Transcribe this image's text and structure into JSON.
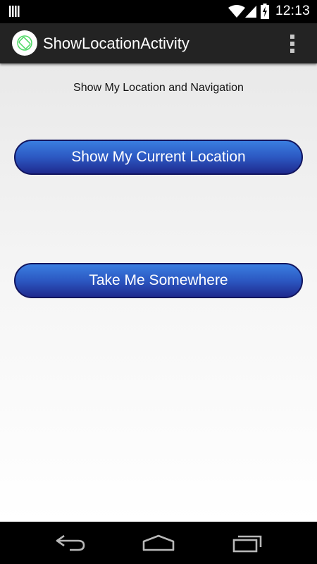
{
  "status_bar": {
    "time": "12:13",
    "icons": [
      "notification-icon",
      "wifi-icon",
      "signal-icon",
      "battery-charging-icon"
    ]
  },
  "action_bar": {
    "title": "ShowLocationActivity",
    "app_icon": "app-logo-icon",
    "overflow_icon": "overflow-menu-icon"
  },
  "main": {
    "subtitle": "Show My Location and Navigation",
    "buttons": [
      {
        "label": "Show My Current Location"
      },
      {
        "label": "Take Me Somewhere"
      }
    ]
  },
  "nav_bar": {
    "icons": [
      "back-icon",
      "home-icon",
      "recents-icon"
    ]
  },
  "colors": {
    "button_top": "#3a7ee0",
    "button_bottom": "#1f2a8e",
    "button_border": "#12155e",
    "action_bar": "#232323",
    "app_icon_accent": "#4cd964"
  }
}
